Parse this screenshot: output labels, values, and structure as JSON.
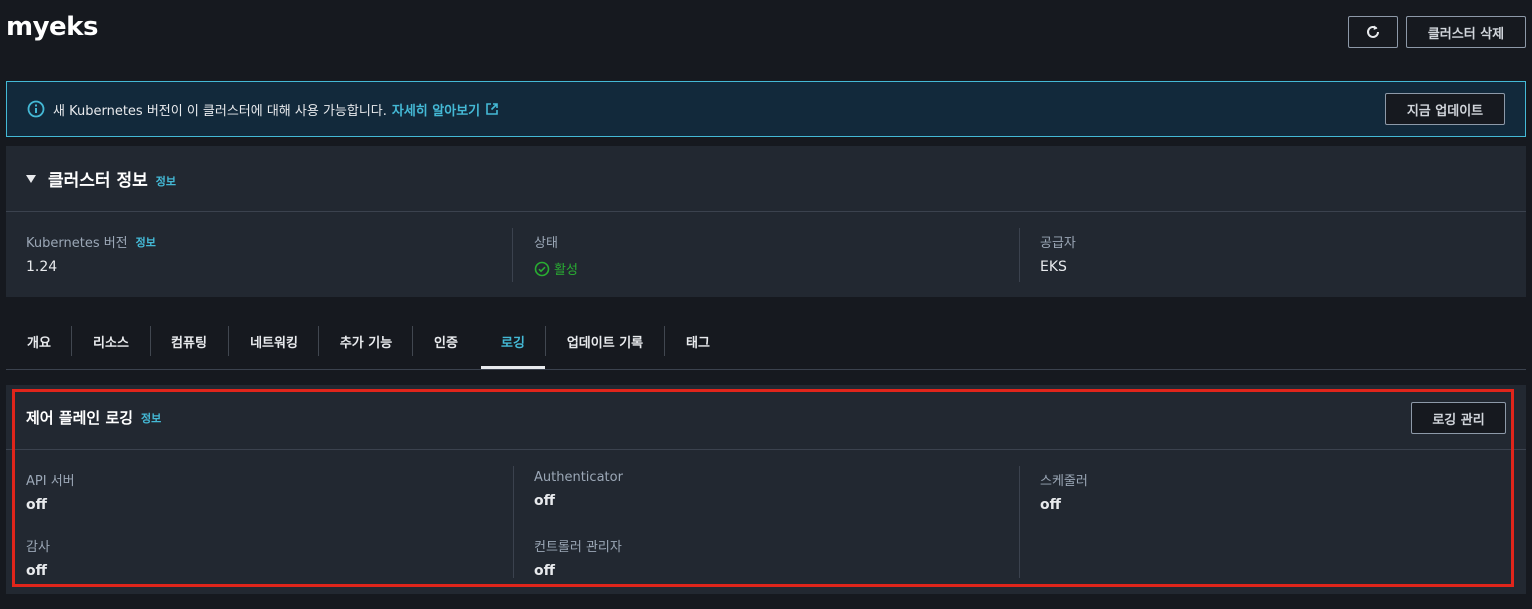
{
  "page": {
    "title": "myeks"
  },
  "header": {
    "delete_label": "클러스터 삭제",
    "refresh_icon": "refresh-icon"
  },
  "banner": {
    "text": "새 Kubernetes 버전이 이 클러스터에 대해 사용 가능합니다.",
    "link": "자세히 알아보기",
    "update_label": "지금 업데이트",
    "accent": "#44b9d6"
  },
  "cluster_info": {
    "title": "클러스터 정보",
    "info_link": "정보",
    "k8s_version_label": "Kubernetes 버전",
    "k8s_version_info": "정보",
    "k8s_version_value": "1.24",
    "status_label": "상태",
    "status_value": "활성",
    "status_color": "#29ad32",
    "provider_label": "공급자",
    "provider_value": "EKS"
  },
  "tabs": [
    {
      "label": "개요"
    },
    {
      "label": "리소스"
    },
    {
      "label": "컴퓨팅"
    },
    {
      "label": "네트워킹"
    },
    {
      "label": "추가 기능"
    },
    {
      "label": "인증"
    },
    {
      "label": "로깅"
    },
    {
      "label": "업데이트 기록"
    },
    {
      "label": "태그"
    }
  ],
  "active_tab": "로깅",
  "logging": {
    "title": "제어 플레인 로깅",
    "info_link": "정보",
    "manage_label": "로깅 관리",
    "items": [
      {
        "label": "API 서버",
        "value": "off"
      },
      {
        "label": "Authenticator",
        "value": "off"
      },
      {
        "label": "스케줄러",
        "value": "off"
      },
      {
        "label": "감사",
        "value": "off"
      },
      {
        "label": "컨트롤러 관리자",
        "value": "off"
      }
    ],
    "highlight_color": "#e0251b"
  }
}
